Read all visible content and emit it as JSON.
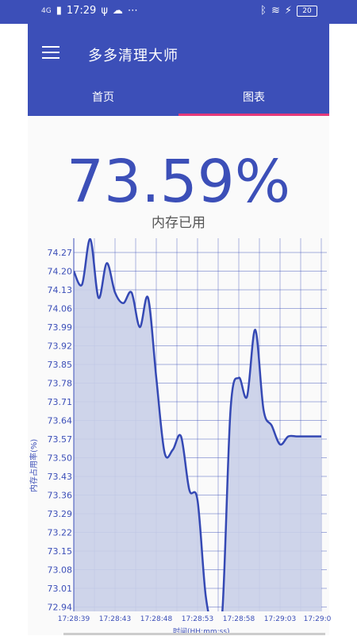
{
  "status_bar": {
    "time": "17:29",
    "network": "4G",
    "battery": "20"
  },
  "app": {
    "title": "多多清理大师"
  },
  "tabs": [
    {
      "label": "首页",
      "active": false
    },
    {
      "label": "图表",
      "active": true
    }
  ],
  "memory": {
    "percent_text": "73.59%",
    "label": "内存已用"
  },
  "chart_data": {
    "type": "area",
    "xlabel": "时间(HH:mm:ss)",
    "ylabel": "内存占用率(%)",
    "y_ticks": [
      "74.27",
      "74.20",
      "74.13",
      "74.06",
      "73.99",
      "73.92",
      "73.85",
      "73.78",
      "73.71",
      "73.64",
      "73.57",
      "73.50",
      "73.43",
      "73.36",
      "73.29",
      "73.22",
      "73.15",
      "73.08",
      "73.01",
      "72.94"
    ],
    "x_ticks": [
      "17:28:39",
      "17:28:43",
      "17:28:48",
      "17:28:53",
      "17:28:58",
      "17:29:03",
      "17:29:0"
    ],
    "ylim": [
      72.94,
      74.27
    ],
    "x": [
      "17:28:39",
      "17:28:40",
      "17:28:41",
      "17:28:42",
      "17:28:43",
      "17:28:44",
      "17:28:45",
      "17:28:46",
      "17:28:47",
      "17:28:48",
      "17:28:49",
      "17:28:50",
      "17:28:51",
      "17:28:52",
      "17:28:53",
      "17:28:54",
      "17:28:55",
      "17:28:56",
      "17:28:57",
      "17:28:58",
      "17:28:59",
      "17:29:00",
      "17:29:01",
      "17:29:02",
      "17:29:03",
      "17:29:04",
      "17:29:05",
      "17:29:06",
      "17:29:07",
      "17:29:08",
      "17:29:09"
    ],
    "values": [
      74.2,
      74.15,
      74.32,
      74.1,
      74.23,
      74.12,
      74.08,
      74.12,
      73.99,
      74.1,
      73.8,
      73.52,
      73.53,
      73.58,
      73.38,
      73.34,
      72.98,
      72.86,
      72.92,
      73.68,
      73.8,
      73.73,
      73.98,
      73.68,
      73.62,
      73.55,
      73.58,
      73.58,
      73.58,
      73.58,
      73.58
    ],
    "grid": true,
    "fill_color": "#c9cfe8",
    "line_color": "#3549b4"
  }
}
